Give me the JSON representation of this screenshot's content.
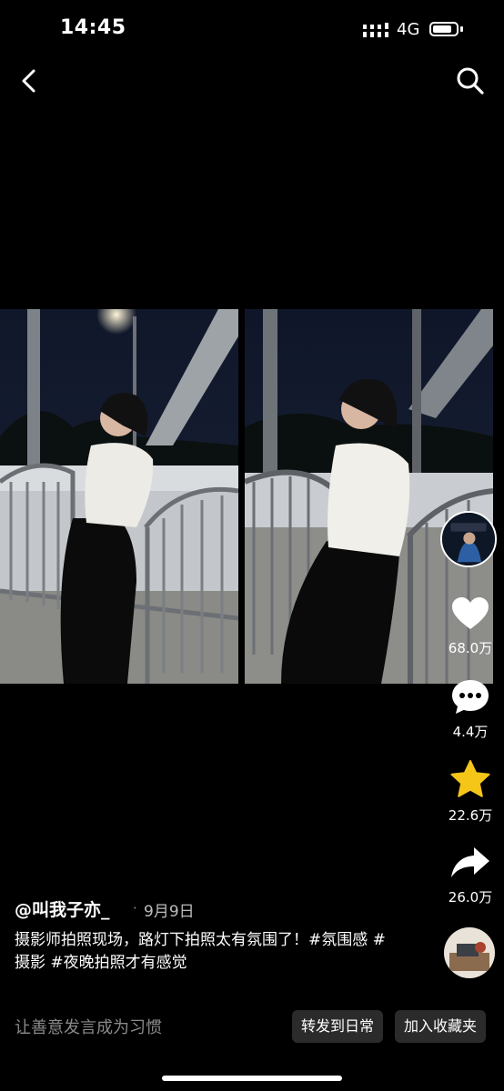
{
  "status_bar": {
    "time": "14:45",
    "network": "4G",
    "battery_level": 0.85
  },
  "nav": {
    "back_icon": "chevron-left-icon",
    "search_icon": "search-icon"
  },
  "post": {
    "author": "@叫我子亦_",
    "separator": "·",
    "date": "9月9日",
    "description": "摄影师拍照现场，路灯下拍照太有氛围了！#氛围感 #摄影 #夜晚拍照才有感觉"
  },
  "actions": {
    "like_count": "68.0万",
    "comment_count": "4.4万",
    "favorite_count": "22.6万",
    "share_count": "26.0万"
  },
  "bottom": {
    "comment_placeholder": "让善意发言成为习惯",
    "repost_label": "转发到日常",
    "collect_label": "加入收藏夹"
  },
  "colors": {
    "background": "#000000",
    "star": "#f5c518",
    "pill_bg": "#2b2b2b"
  }
}
